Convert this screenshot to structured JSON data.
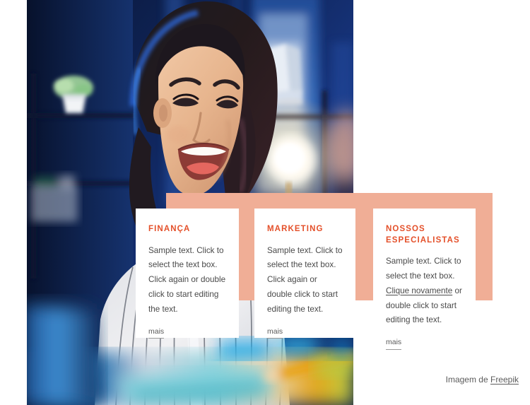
{
  "colors": {
    "accent_heading": "#e4502a",
    "panel_peach": "#f0ae96",
    "card_background": "#ffffff",
    "page_background": "#ffffff",
    "body_text": "#4a4a4a"
  },
  "photo": {
    "alt": "Smiling young woman in a striped shirt in a blue-lit office at night",
    "palette": {
      "background_blue_dark": "#0a1a3f",
      "background_blue": "#16307a",
      "background_blue_light": "#2a56b8",
      "skin": "#e8b592",
      "hair": "#201a1c",
      "shirt": "#e9e9ec",
      "lamp_glow": "#fff6de",
      "desk_mug": "#2f7fc4",
      "desk_yellow": "#e9a316"
    }
  },
  "cards": [
    {
      "title": "FINANÇA",
      "body_before_link": "Sample text. Click to select the text box. Click again or double click to start editing the text.",
      "link_text": "",
      "body_after_link": "",
      "more_label": "mais"
    },
    {
      "title": "MARKETING",
      "body_before_link": "Sample text. Click to select the text box. Click again or double click to start editing the text.",
      "link_text": "",
      "body_after_link": "",
      "more_label": "mais"
    },
    {
      "title": "NOSSOS ESPECIALISTAS",
      "body_before_link": "Sample text. Click to select the text box. ",
      "link_text": "Clique novamente",
      "body_after_link": " or double click to start editing the text.",
      "more_label": "mais"
    }
  ],
  "credit": {
    "prefix": "Imagem de ",
    "link_label": "Freepik"
  }
}
